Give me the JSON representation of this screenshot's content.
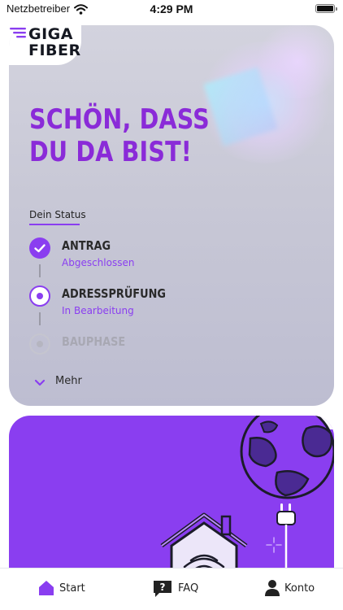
{
  "status_bar": {
    "carrier": "Netzbetreiber",
    "time": "4:29 PM"
  },
  "logo": {
    "line1": "GIGA",
    "line2": "FIBER"
  },
  "status_card": {
    "headline_line1": "SCHÖN, DASS",
    "headline_line2": "DU DA BIST!",
    "status_label": "Dein Status",
    "steps": [
      {
        "title": "ANTRAG",
        "subtitle": "Abgeschlossen",
        "state": "done"
      },
      {
        "title": "ADRESSPRÜFUNG",
        "subtitle": "In Bearbeitung",
        "state": "active"
      },
      {
        "title": "BAUPHASE",
        "subtitle": "",
        "state": "pending"
      }
    ],
    "more_label": "Mehr"
  },
  "tab_bar": {
    "tabs": [
      {
        "label": "Start",
        "icon": "home-icon"
      },
      {
        "label": "FAQ",
        "icon": "question-icon"
      },
      {
        "label": "Konto",
        "icon": "user-icon"
      }
    ]
  },
  "colors": {
    "accent": "#8a3ef0",
    "headline": "#8a2bd8",
    "card_background": "#c8c8d6",
    "globe": "#4a2a93"
  }
}
